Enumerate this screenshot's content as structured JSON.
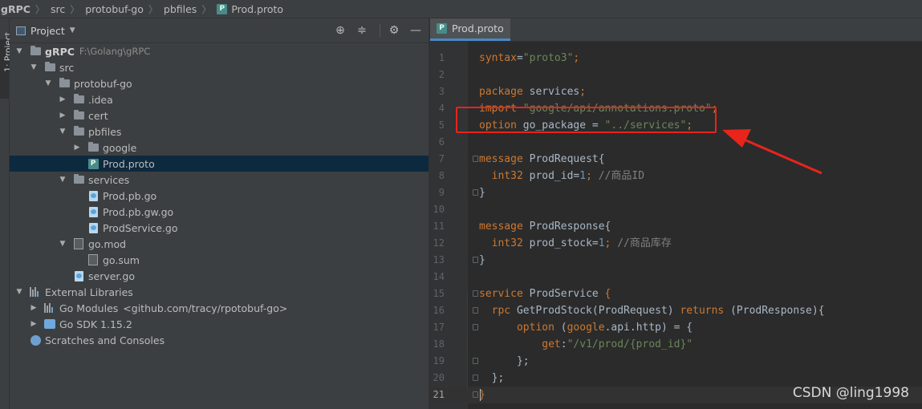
{
  "breadcrumb": [
    "gRPC",
    "src",
    "protobuf-go",
    "pbfiles",
    "Prod.proto"
  ],
  "left_stripe": {
    "label": "1: Project"
  },
  "project_panel": {
    "title": "Project",
    "tools": [
      "locate-icon",
      "collapse-icon",
      "gear-icon",
      "minimize-icon"
    ],
    "tree": [
      {
        "label": "gRPC",
        "hint": "F:\\Golang\\gRPC",
        "icon": "folder-icon",
        "expanded": true,
        "bold": true
      },
      {
        "label": "src",
        "icon": "folder-icon",
        "expanded": true
      },
      {
        "label": "protobuf-go",
        "icon": "folder-icon",
        "expanded": true
      },
      {
        "label": ".idea",
        "icon": "folder-icon",
        "expanded": false
      },
      {
        "label": "cert",
        "icon": "folder-icon",
        "expanded": false
      },
      {
        "label": "pbfiles",
        "icon": "folder-icon",
        "expanded": true
      },
      {
        "label": "google",
        "icon": "folder-icon",
        "expanded": false
      },
      {
        "label": "Prod.proto",
        "icon": "proto-file-icon",
        "selected": true
      },
      {
        "label": "services",
        "icon": "folder-icon",
        "expanded": true
      },
      {
        "label": "Prod.pb.go",
        "icon": "go-file-icon"
      },
      {
        "label": "Prod.pb.gw.go",
        "icon": "go-file-icon"
      },
      {
        "label": "ProdService.go",
        "icon": "go-file-icon"
      },
      {
        "label": "go.mod",
        "icon": "go-mod-icon",
        "expanded": true
      },
      {
        "label": "go.sum",
        "icon": "go-sum-icon"
      },
      {
        "label": "server.go",
        "icon": "go-file-icon"
      },
      {
        "label": "External Libraries",
        "icon": "libraries-icon",
        "expanded": true
      },
      {
        "label": "Go Modules",
        "hint": "<github.com/tracy/rpotobuf-go>",
        "icon": "libraries-icon",
        "expanded": false
      },
      {
        "label": "Go SDK 1.15.2",
        "icon": "go-sdk-icon",
        "expanded": false
      },
      {
        "label": "Scratches and Consoles",
        "icon": "scratch-icon"
      }
    ]
  },
  "editor": {
    "tab_label": "Prod.proto",
    "current_line": 21,
    "lines": [
      {
        "n": "1",
        "tokens": [
          [
            "kw",
            "syntax"
          ],
          [
            "pl",
            "="
          ],
          [
            "str",
            "\"proto3\""
          ],
          [
            "kw",
            ";"
          ]
        ]
      },
      {
        "n": "2",
        "tokens": []
      },
      {
        "n": "3",
        "tokens": [
          [
            "kw",
            "package"
          ],
          [
            "pl",
            " services"
          ],
          [
            "kw",
            ";"
          ]
        ]
      },
      {
        "n": "4",
        "tokens": [
          [
            "kw",
            "import"
          ],
          [
            "pl",
            " "
          ],
          [
            "str",
            "\"google/api/annotations.proto\""
          ],
          [
            "kw",
            ";"
          ]
        ]
      },
      {
        "n": "5",
        "tokens": [
          [
            "kw",
            "option"
          ],
          [
            "pl",
            " go_package = "
          ],
          [
            "str",
            "\"../services\""
          ],
          [
            "kw",
            ";"
          ]
        ]
      },
      {
        "n": "6",
        "tokens": []
      },
      {
        "n": "7",
        "tokens": [
          [
            "kw",
            "message"
          ],
          [
            "pl",
            " ProdRequest{"
          ]
        ]
      },
      {
        "n": "8",
        "tokens": [
          [
            "pl",
            "  "
          ],
          [
            "kw",
            "int32"
          ],
          [
            "pl",
            " prod_id="
          ],
          [
            "num",
            "1"
          ],
          [
            "kw",
            ";"
          ],
          [
            "pl",
            " "
          ],
          [
            "cm",
            "//商品ID"
          ]
        ]
      },
      {
        "n": "9",
        "tokens": [
          [
            "pl",
            "}"
          ]
        ]
      },
      {
        "n": "10",
        "tokens": []
      },
      {
        "n": "11",
        "tokens": [
          [
            "kw",
            "message"
          ],
          [
            "pl",
            " ProdResponse{"
          ]
        ]
      },
      {
        "n": "12",
        "tokens": [
          [
            "pl",
            "  "
          ],
          [
            "kw",
            "int32"
          ],
          [
            "pl",
            " prod_stock="
          ],
          [
            "num",
            "1"
          ],
          [
            "kw",
            ";"
          ],
          [
            "pl",
            " "
          ],
          [
            "cm",
            "//商品库存"
          ]
        ]
      },
      {
        "n": "13",
        "tokens": [
          [
            "pl",
            "}"
          ]
        ]
      },
      {
        "n": "14",
        "tokens": []
      },
      {
        "n": "15",
        "tokens": [
          [
            "kw",
            "service"
          ],
          [
            "pl",
            " ProdService "
          ],
          [
            "kw",
            "{"
          ]
        ]
      },
      {
        "n": "16",
        "tokens": [
          [
            "pl",
            "  "
          ],
          [
            "kw",
            "rpc"
          ],
          [
            "pl",
            " GetProdStock(ProdRequest) "
          ],
          [
            "kw",
            "returns"
          ],
          [
            "pl",
            " (ProdResponse){"
          ]
        ]
      },
      {
        "n": "17",
        "tokens": [
          [
            "pl",
            "      "
          ],
          [
            "kw",
            "option"
          ],
          [
            "pl",
            " ("
          ],
          [
            "kw",
            "google"
          ],
          [
            "pl",
            ".api.http) = {"
          ]
        ]
      },
      {
        "n": "18",
        "tokens": [
          [
            "pl",
            "          "
          ],
          [
            "kw",
            "get"
          ],
          [
            "pl",
            ":"
          ],
          [
            "str",
            "\"/v1/prod/{prod_id}\""
          ]
        ]
      },
      {
        "n": "19",
        "tokens": [
          [
            "pl",
            "      };"
          ]
        ]
      },
      {
        "n": "20",
        "tokens": [
          [
            "pl",
            "  };"
          ]
        ]
      },
      {
        "n": "21",
        "tokens": [
          [
            "kw",
            "}"
          ]
        ]
      }
    ]
  },
  "annotation": {
    "color": "#e8241b"
  },
  "watermark": "CSDN @ling1998"
}
